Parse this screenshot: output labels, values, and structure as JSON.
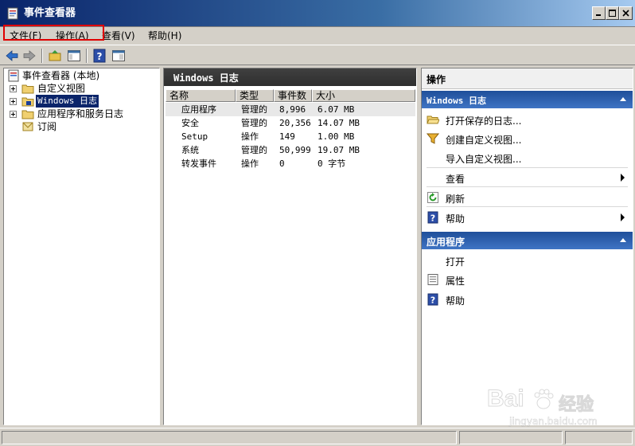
{
  "window": {
    "title": "事件查看器"
  },
  "menubar": {
    "items": [
      "文件(F)",
      "操作(A)",
      "查看(V)",
      "帮助(H)"
    ]
  },
  "toolbar": {
    "buttons": [
      "back-icon",
      "forward-icon",
      "up-folder-icon",
      "show-tree-icon",
      "help-icon",
      "show-action-pane-icon"
    ]
  },
  "tree": {
    "root": "事件查看器 (本地)",
    "items": [
      {
        "label": "自定义视图",
        "expandable": true
      },
      {
        "label": "Windows 日志",
        "expandable": true,
        "selected": true
      },
      {
        "label": "应用程序和服务日志",
        "expandable": true
      },
      {
        "label": "订阅",
        "expandable": false
      }
    ]
  },
  "list": {
    "title": "Windows 日志",
    "columns": [
      "名称",
      "类型",
      "事件数",
      "大小"
    ],
    "rows": [
      {
        "name": "应用程序",
        "type": "管理的",
        "count": "8,996",
        "size": "6.07 MB"
      },
      {
        "name": "安全",
        "type": "管理的",
        "count": "20,356",
        "size": "14.07 MB"
      },
      {
        "name": "Setup",
        "type": "操作",
        "count": "149",
        "size": "1.00 MB"
      },
      {
        "name": "系统",
        "type": "管理的",
        "count": "50,999",
        "size": "19.07 MB"
      },
      {
        "name": "转发事件",
        "type": "操作",
        "count": "0",
        "size": "0 字节"
      }
    ]
  },
  "actions": {
    "title": "操作",
    "section1": {
      "title": "Windows 日志",
      "items": [
        "打开保存的日志...",
        "创建自定义视图...",
        "导入自定义视图...",
        "查看",
        "刷新",
        "帮助"
      ]
    },
    "section2": {
      "title": "应用程序",
      "items": [
        "打开",
        "属性",
        "帮助"
      ]
    }
  },
  "watermark": {
    "brand": "Bai",
    "brand2": "经验",
    "url": "jingyan.baidu.com"
  },
  "colors": {
    "titlebar": "#0a246a",
    "section": "#1f4f9a",
    "highlight": "#e00000"
  }
}
